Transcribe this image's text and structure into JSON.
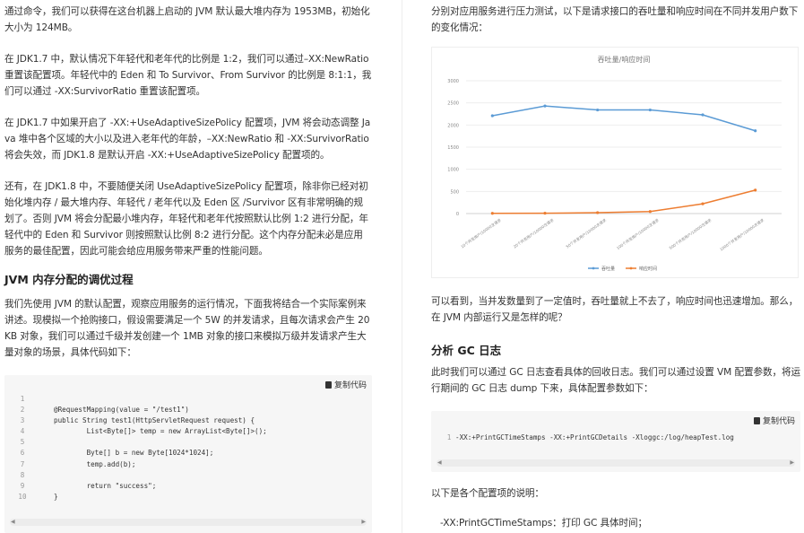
{
  "left": {
    "p1": "通过命令，我们可以获得在这台机器上启动的 JVM 默认最大堆内存为 1953MB，初始化大小为 124MB。",
    "p2": "在 JDK1.7 中，默认情况下年轻代和老年代的比例是 1:2，我们可以通过–XX:NewRatio 重置该配置项。年轻代中的 Eden 和 To Survivor、From Survivor 的比例是 8:1:1，我们可以通过 -XX:SurvivorRatio 重置该配置项。",
    "p3": "在 JDK1.7 中如果开启了 -XX:+UseAdaptiveSizePolicy 配置项，JVM 将会动态调整 Java 堆中各个区域的大小以及进入老年代的年龄，–XX:NewRatio 和 -XX:SurvivorRatio 将会失效，而 JDK1.8 是默认开启 -XX:+UseAdaptiveSizePolicy 配置项的。",
    "p4": "还有，在 JDK1.8 中，不要随便关闭 UseAdaptiveSizePolicy 配置项，除非你已经对初始化堆内存 / 最大堆内存、年轻代 / 老年代以及 Eden 区 /Survivor 区有非常明确的规划了。否则 JVM 将会分配最小堆内存，年轻代和老年代按照默认比例 1:2 进行分配，年轻代中的 Eden 和 Survivor 则按照默认比例 8:2 进行分配。这个内存分配未必是应用服务的最佳配置，因此可能会给应用服务带来严重的性能问题。",
    "h1": "JVM 内存分配的调优过程",
    "p5": "我们先使用 JVM 的默认配置，观察应用服务的运行情况，下面我将结合一个实际案例来讲述。现模拟一个抢购接口，假设需要满足一个 5W 的并发请求，且每次请求会产生 20KB 对象，我们可以通过千级并发创建一个 1MB 对象的接口来模拟万级并发请求产生大量对象的场景，具体代码如下：",
    "copy_label": "复制代码",
    "code": [
      {
        "n": "1",
        "t": ""
      },
      {
        "n": "2",
        "t": "@RequestMapping(value = \"/test1\")"
      },
      {
        "n": "3",
        "t": "public String test1(HttpServletRequest request) {"
      },
      {
        "n": "4",
        "t": "        List<Byte[]> temp = new ArrayList<Byte[]>();"
      },
      {
        "n": "5",
        "t": ""
      },
      {
        "n": "6",
        "t": "        Byte[] b = new Byte[1024*1024];"
      },
      {
        "n": "7",
        "t": "        temp.add(b);"
      },
      {
        "n": "8",
        "t": ""
      },
      {
        "n": "9",
        "t": "        return \"success\";"
      },
      {
        "n": "10",
        "t": "}"
      }
    ]
  },
  "right": {
    "p1": "分别对应用服务进行压力测试，以下是请求接口的吞吐量和响应时间在不同并发用户数下的变化情况：",
    "p2": "可以看到，当并发数量到了一定值时，吞吐量就上不去了，响应时间也迅速增加。那么，在 JVM 内部运行又是怎样的呢？",
    "h1": "分析 GC 日志",
    "p3": "此时我们可以通过 GC 日志查看具体的回收日志。我们可以通过设置 VM 配置参数，将运行期间的 GC 日志 dump 下来，具体配置参数如下：",
    "copy_label": "复制代码",
    "code": [
      {
        "n": "1",
        "t": "-XX:+PrintGCTimeStamps -XX:+PrintGCDetails -Xloggc:/log/heapTest.log"
      }
    ],
    "p4": "以下是各个配置项的说明：",
    "p5": "-XX:PrintGCTimeStamps：打印 GC 具体时间；"
  },
  "chart_data": {
    "type": "line",
    "title": "吞吐量/响应时间",
    "categories": [
      "10个并发用户/10000次请求",
      "20个并发用户/10000次请求",
      "50个并发用户/10000次请求",
      "100个并发用户/10000次请求",
      "500个并发用户/10000次请求",
      "1000个并发用户/10000次请求"
    ],
    "series": [
      {
        "name": "吞吐量",
        "color": "#5b9bd5",
        "values": [
          2210,
          2430,
          2340,
          2340,
          2230,
          1870
        ]
      },
      {
        "name": "响应时间",
        "color": "#ed7d31",
        "values": [
          5,
          8,
          20,
          45,
          220,
          530
        ]
      }
    ],
    "yticks": [
      "0",
      "500",
      "1000",
      "1500",
      "2000",
      "2500",
      "3000"
    ],
    "ylim": [
      0,
      3000
    ],
    "grid": true,
    "legend": "bottom"
  }
}
